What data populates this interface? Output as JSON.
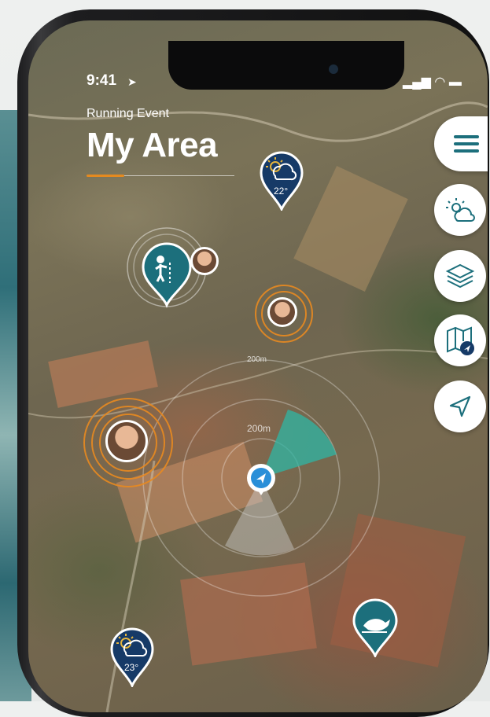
{
  "status_bar": {
    "time": "9:41"
  },
  "header": {
    "subtitle": "Running Event",
    "title": "My Area"
  },
  "map": {
    "weather_pins": [
      {
        "temp": "22°"
      },
      {
        "temp": "23°"
      }
    ],
    "distance_labels": [
      "200m"
    ]
  },
  "toolbar": {
    "buttons": [
      {
        "icon": "menu-icon"
      },
      {
        "icon": "weather-icon"
      },
      {
        "icon": "layers-icon"
      },
      {
        "icon": "map-icon"
      },
      {
        "icon": "navigate-icon"
      }
    ]
  },
  "colors": {
    "accent": "#1c6f7c",
    "navy": "#163a67",
    "orange": "#e58a1f"
  }
}
